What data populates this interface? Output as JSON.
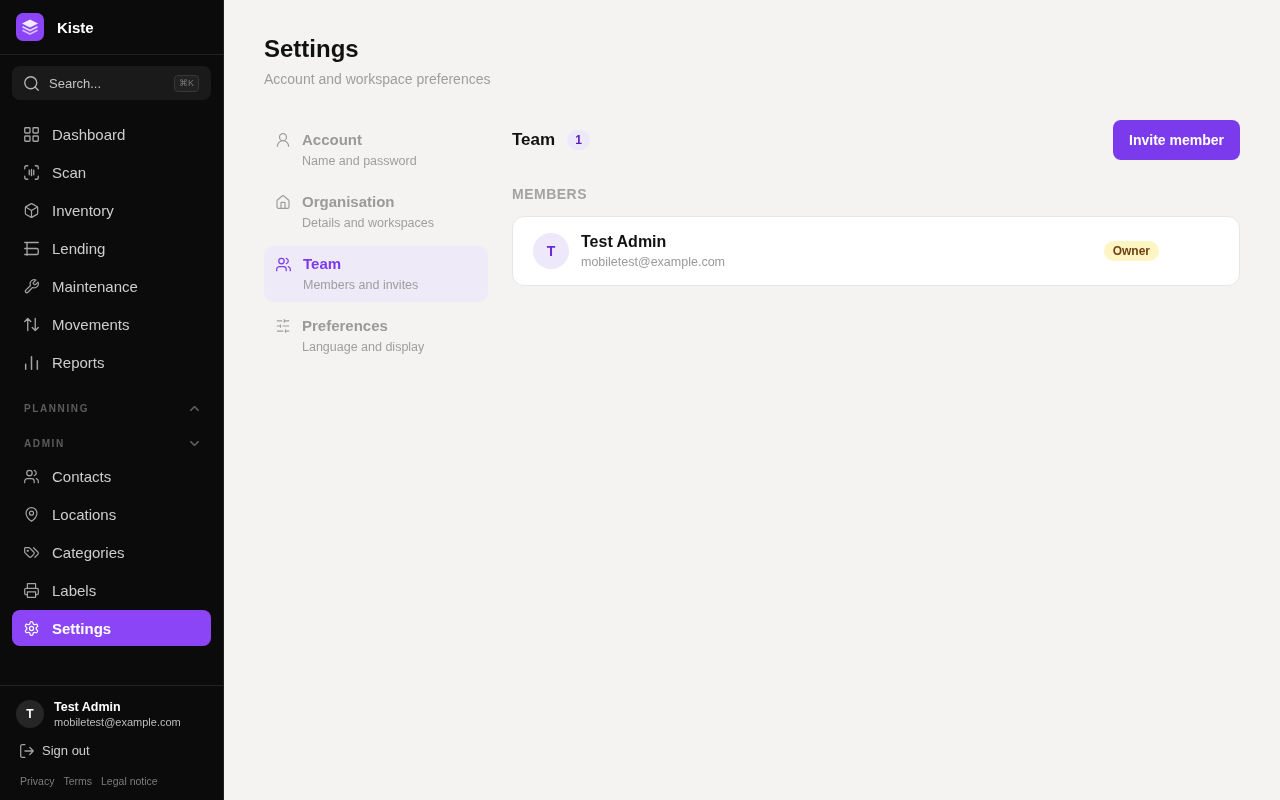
{
  "app": {
    "name": "Kiste"
  },
  "search": {
    "placeholder": "Search...",
    "shortcut": "⌘K"
  },
  "sidebar": {
    "items": [
      {
        "label": "Dashboard",
        "selected": false
      },
      {
        "label": "Scan",
        "selected": false
      },
      {
        "label": "Inventory",
        "selected": false
      },
      {
        "label": "Lending",
        "selected": false
      },
      {
        "label": "Maintenance",
        "selected": false
      },
      {
        "label": "Movements",
        "selected": false
      },
      {
        "label": "Reports",
        "selected": false
      }
    ],
    "sections": [
      {
        "title": "PLANNING",
        "expanded": false
      },
      {
        "title": "ADMIN",
        "expanded": true,
        "items": [
          {
            "label": "Contacts",
            "selected": false
          },
          {
            "label": "Locations",
            "selected": false
          },
          {
            "label": "Categories",
            "selected": false
          },
          {
            "label": "Labels",
            "selected": false
          },
          {
            "label": "Settings",
            "selected": true
          }
        ]
      }
    ]
  },
  "user": {
    "initial": "T",
    "name": "Test Admin",
    "email": "mobiletest@example.com"
  },
  "sign_out": "Sign out",
  "footer_links": [
    "Privacy",
    "Terms",
    "Legal notice"
  ],
  "page": {
    "title": "Settings",
    "subtitle": "Account and workspace preferences"
  },
  "settings_nav": {
    "items": [
      {
        "title": "Account",
        "subtitle": "Name and password",
        "selected": false
      },
      {
        "title": "Organisation",
        "subtitle": "Details and workspaces",
        "selected": false
      },
      {
        "title": "Team",
        "subtitle": "Members and invites",
        "selected": true
      },
      {
        "title": "Preferences",
        "subtitle": "Language and display",
        "selected": false
      }
    ]
  },
  "team": {
    "title": "Team",
    "count": "1",
    "invite_button": "Invite member",
    "members_label": "MEMBERS",
    "members": [
      {
        "initial": "T",
        "name": "Test Admin",
        "email": "mobiletest@example.com",
        "role": "Owner"
      }
    ]
  }
}
